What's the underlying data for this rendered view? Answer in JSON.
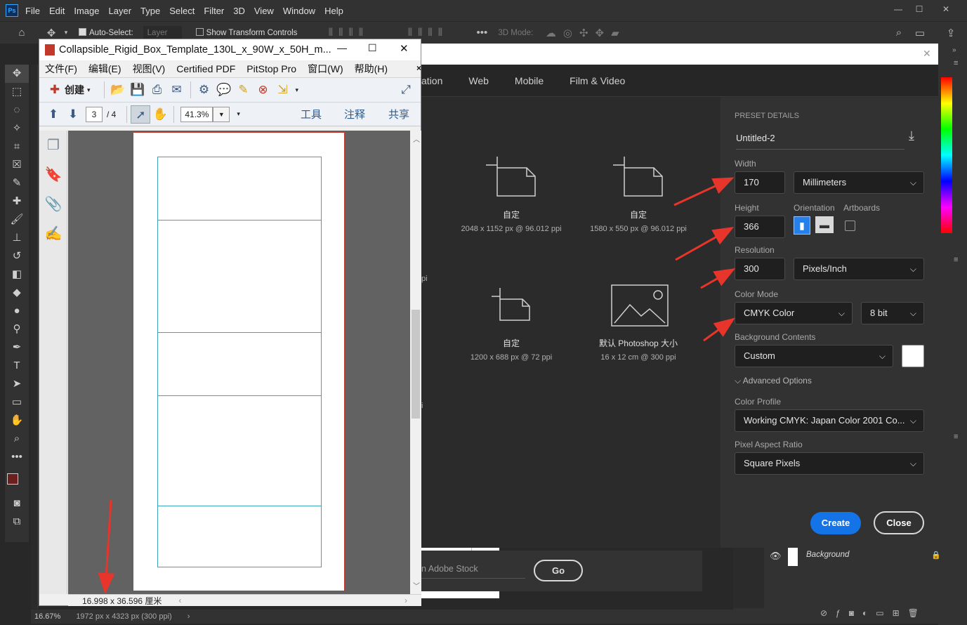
{
  "ps": {
    "logo": "Ps",
    "menu": [
      "File",
      "Edit",
      "Image",
      "Layer",
      "Type",
      "Select",
      "Filter",
      "3D",
      "View",
      "Window",
      "Help"
    ],
    "options": {
      "auto_select_label": "Auto-Select:",
      "auto_select_value": "Layer",
      "show_transform_label": "Show Transform Controls",
      "mode_3d_label": "3D Mode:"
    },
    "status": {
      "zoom": "16.67%",
      "doc_info": "1972 px x 4323 px (300 ppi)"
    },
    "layers": {
      "background_name": "Background"
    }
  },
  "acrobat": {
    "title": "Collapsible_Rigid_Box_Template_130L_x_90W_x_50H_m...",
    "menu": [
      "文件(F)",
      "编辑(E)",
      "视图(V)",
      "Certified PDF",
      "PitStop Pro",
      "窗口(W)",
      "帮助(H)"
    ],
    "create_label": "创建",
    "page_current": "3",
    "page_total": "/ 4",
    "zoom": "41.3%",
    "tools_label": "工具",
    "comment_label": "注释",
    "share_label": "共享",
    "page_size": "16.998 x 36.596 厘米"
  },
  "dialog": {
    "tabs": [
      "ation",
      "Web",
      "Mobile",
      "Film & Video"
    ],
    "presets": [
      {
        "name": "自定",
        "desc": "2048 x 1152 px @ 96.012 ppi"
      },
      {
        "name": "自定",
        "desc": "1580 x 550 px @ 96.012 ppi"
      },
      {
        "name": "自定",
        "desc": "1200 x 688 px @ 72 ppi"
      },
      {
        "name": "默认 Photoshop 大小",
        "desc": "16 x 12 cm @ 300 ppi"
      }
    ],
    "clip_left_1": "pi",
    "clip_left_2": "i",
    "stock_placeholder": "n Adobe Stock",
    "go_label": "Go",
    "details": {
      "header": "PRESET DETAILS",
      "doc_name": "Untitled-2",
      "width_label": "Width",
      "width_value": "170",
      "width_unit": "Millimeters",
      "height_label": "Height",
      "height_value": "366",
      "orientation_label": "Orientation",
      "artboards_label": "Artboards",
      "resolution_label": "Resolution",
      "resolution_value": "300",
      "resolution_unit": "Pixels/Inch",
      "color_mode_label": "Color Mode",
      "color_mode_value": "CMYK Color",
      "bit_depth": "8 bit",
      "bg_label": "Background Contents",
      "bg_value": "Custom",
      "advanced_label": "Advanced Options",
      "profile_label": "Color Profile",
      "profile_value": "Working CMYK: Japan Color 2001 Co...",
      "par_label": "Pixel Aspect Ratio",
      "par_value": "Square Pixels",
      "create_label": "Create",
      "close_label": "Close"
    }
  },
  "colors": {
    "accent_blue": "#1473e6",
    "arrow_red": "#e8352c",
    "ps_bg": "#323232",
    "foreground_swatch": "#6b1f1f"
  }
}
